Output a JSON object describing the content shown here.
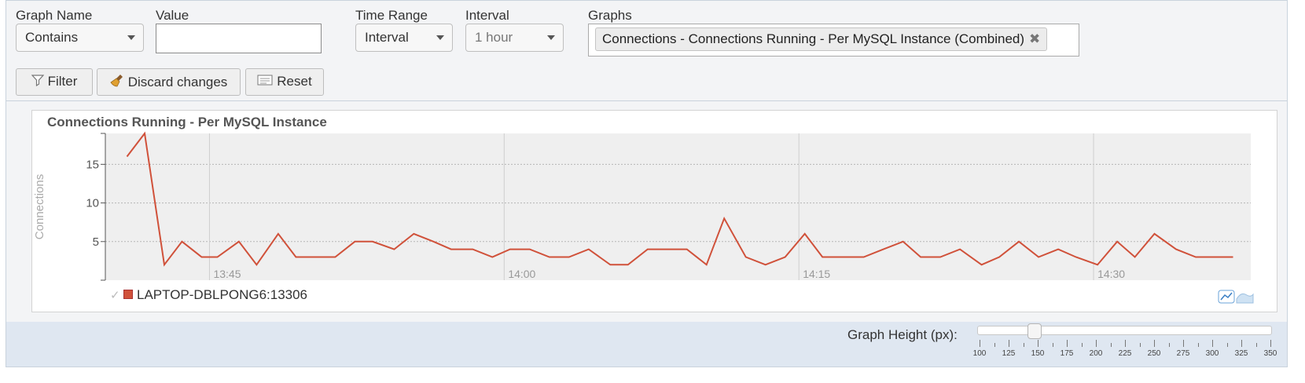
{
  "filters": {
    "graph_name_label": "Graph Name",
    "graph_name_value": "Contains",
    "value_label": "Value",
    "value_input": "",
    "time_range_label": "Time Range",
    "time_range_value": "Interval",
    "interval_label": "Interval",
    "interval_value": "1 hour",
    "graphs_label": "Graphs",
    "graphs_selected": "Connections - Connections Running - Per MySQL Instance (Combined)"
  },
  "buttons": {
    "filter": "Filter",
    "discard": "Discard changes",
    "reset": "Reset"
  },
  "graph": {
    "title": "Connections Running - Per MySQL Instance",
    "legend_label": "LAPTOP-DBLPONG6:13306"
  },
  "height_control": {
    "label": "Graph Height (px):",
    "ticks": [
      "100",
      "125",
      "150",
      "175",
      "200",
      "225",
      "250",
      "275",
      "300",
      "325",
      "350"
    ],
    "value": 150
  },
  "colors": {
    "series": "#d0513a",
    "plot_bg": "#efefef"
  },
  "chart_data": {
    "type": "line",
    "title": "Connections Running - Per MySQL Instance",
    "ylabel": "Connections",
    "xlabel": "",
    "ylim": [
      0,
      19
    ],
    "yticks": [
      5,
      10,
      15
    ],
    "xticks": [
      "13:45",
      "14:00",
      "14:15",
      "14:30"
    ],
    "xtick_minutes": [
      45,
      60,
      75,
      90
    ],
    "grid": true,
    "legend": "bottom-left",
    "series": [
      {
        "name": "LAPTOP-DBLPONG6:13306",
        "minutes": [
          40.8,
          41.7,
          42.7,
          43.6,
          44.6,
          45.4,
          46.5,
          47.4,
          48.5,
          49.4,
          50.5,
          51.4,
          52.4,
          53.3,
          54.4,
          55.4,
          56.4,
          57.3,
          58.4,
          59.4,
          60.3,
          61.3,
          62.3,
          63.3,
          64.3,
          65.4,
          66.3,
          67.3,
          68.3,
          69.3,
          70.3,
          71.2,
          72.3,
          73.3,
          74.3,
          75.3,
          76.2,
          77.3,
          78.3,
          79.3,
          80.3,
          81.2,
          82.2,
          83.2,
          84.3,
          85.2,
          86.2,
          87.2,
          88.2,
          89.1,
          90.2,
          91.2,
          92.1,
          93.1,
          94.2,
          95.2,
          96.1,
          97.1
        ],
        "values": [
          16,
          19,
          2,
          5,
          3,
          3,
          5,
          2,
          6,
          3,
          3,
          3,
          5,
          5,
          4,
          6,
          5,
          4,
          4,
          3,
          4,
          4,
          3,
          3,
          4,
          2,
          2,
          4,
          4,
          4,
          2,
          8,
          3,
          2,
          3,
          6,
          3,
          3,
          3,
          4,
          5,
          3,
          3,
          4,
          2,
          3,
          5,
          3,
          4,
          3,
          2,
          5,
          3,
          6,
          4,
          3,
          3,
          3
        ]
      }
    ]
  }
}
